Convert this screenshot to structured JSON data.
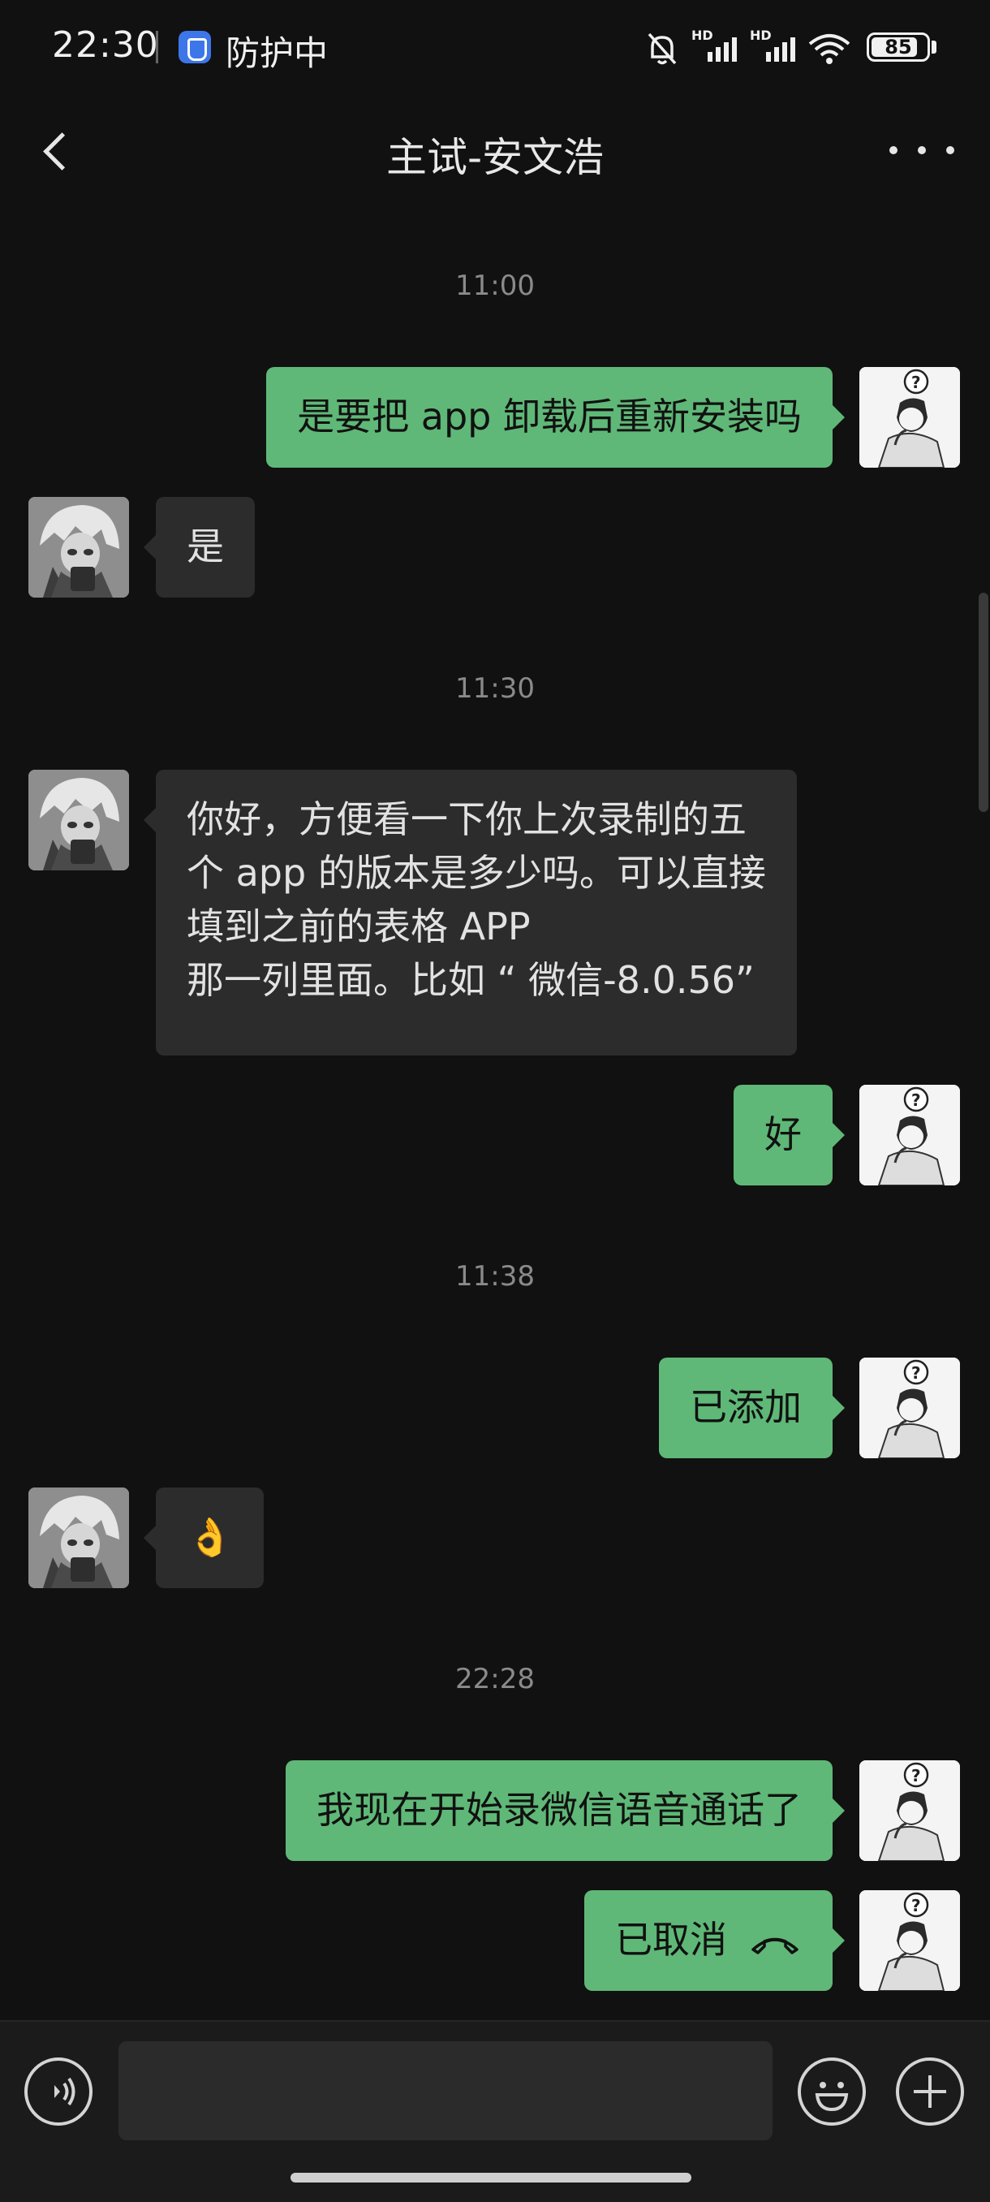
{
  "status_bar": {
    "time": "22:30",
    "protect_text": "防护中",
    "hd_label": "HD",
    "battery": "85",
    "battery_level": 0.85
  },
  "header": {
    "title": "主试-安文浩"
  },
  "messages": [
    {
      "type": "timestamp",
      "text": "11:00"
    },
    {
      "type": "message",
      "sender": "self",
      "lines": [
        "是要把 app 卸载后重新安装吗"
      ]
    },
    {
      "type": "message",
      "sender": "other",
      "lines": [
        "是"
      ]
    },
    {
      "type": "timestamp",
      "text": "11:30"
    },
    {
      "type": "message",
      "sender": "other",
      "lines": [
        "你好，方便看一下你上次录制的五",
        "个 app 的版本是多少吗。可以直接",
        "填到之前的表格 APP",
        "那一列里面。比如 “ 微信-8.0.56”"
      ]
    },
    {
      "type": "message",
      "sender": "self",
      "lines": [
        "好"
      ]
    },
    {
      "type": "timestamp",
      "text": "11:38"
    },
    {
      "type": "message",
      "sender": "self",
      "lines": [
        "已添加"
      ]
    },
    {
      "type": "message",
      "sender": "other",
      "lines": [
        "👌"
      ]
    },
    {
      "type": "timestamp",
      "text": "22:28"
    },
    {
      "type": "message",
      "sender": "self",
      "lines": [
        "我现在开始录微信语音通话了"
      ]
    },
    {
      "type": "call",
      "sender": "self",
      "lines": [
        "已取消"
      ],
      "icon": "hang-up-icon"
    }
  ],
  "input_bar": {
    "text": ""
  },
  "colors": {
    "background": "#111111",
    "self_bubble": "#5fb877",
    "other_bubble": "#2c2c2c"
  }
}
